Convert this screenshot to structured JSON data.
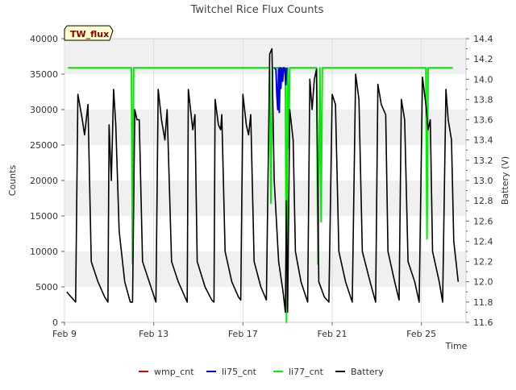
{
  "chart_data": {
    "type": "line",
    "title": "Twitchel Rice Flux Counts",
    "badge": "TW_flux",
    "xlabel": "Time",
    "ylabel": "Counts",
    "y2label": "Battery (V)",
    "x_ticks": [
      {
        "label": "Feb 9",
        "day": 9
      },
      {
        "label": "Feb 13",
        "day": 13
      },
      {
        "label": "Feb 17",
        "day": 17
      },
      {
        "label": "Feb 21",
        "day": 21
      },
      {
        "label": "Feb 25",
        "day": 25
      }
    ],
    "xlim_days": [
      9,
      27
    ],
    "ylim": [
      0,
      40000
    ],
    "y_ticks": [
      0,
      5000,
      10000,
      15000,
      20000,
      25000,
      30000,
      35000,
      40000
    ],
    "y2lim": [
      11.6,
      14.4
    ],
    "y2_ticks": [
      "11.6",
      "11.8",
      "12.0",
      "12.2",
      "12.4",
      "12.6",
      "12.8",
      "13.0",
      "13.2",
      "13.4",
      "13.6",
      "13.8",
      "14.0",
      "14.2",
      "14.4"
    ],
    "grid": "banded",
    "legend_position": "bottom",
    "series": [
      {
        "name": "wmp_cnt",
        "color": "#dd0000",
        "points": []
      },
      {
        "name": "li75_cnt",
        "color": "#0000dd",
        "points": [
          [
            18.42,
            35900
          ],
          [
            18.48,
            35600
          ],
          [
            18.52,
            32000
          ],
          [
            18.56,
            30000
          ],
          [
            18.6,
            35800
          ],
          [
            18.63,
            29600
          ],
          [
            18.67,
            35900
          ],
          [
            18.7,
            33000
          ],
          [
            18.74,
            35800
          ],
          [
            18.78,
            34000
          ],
          [
            18.82,
            35900
          ],
          [
            18.88,
            35800
          ],
          [
            18.92,
            33500
          ],
          [
            18.96,
            35900
          ]
        ]
      },
      {
        "name": "li77_cnt",
        "color": "#00ee00",
        "points": [
          [
            9.15,
            35900
          ],
          [
            11.9,
            35900
          ],
          [
            12.0,
            35900
          ],
          [
            12.05,
            8300
          ],
          [
            12.1,
            35900
          ],
          [
            18.1,
            35900
          ],
          [
            18.2,
            35900
          ],
          [
            18.25,
            16800
          ],
          [
            18.32,
            35900
          ],
          [
            18.5,
            35900
          ],
          [
            18.9,
            35900
          ],
          [
            18.95,
            0
          ],
          [
            19.0,
            35900
          ],
          [
            19.05,
            24500
          ],
          [
            19.1,
            35900
          ],
          [
            20.3,
            35900
          ],
          [
            20.36,
            8200
          ],
          [
            20.45,
            35900
          ],
          [
            20.5,
            14200
          ],
          [
            20.56,
            35900
          ],
          [
            25.2,
            35900
          ],
          [
            25.25,
            11800
          ],
          [
            25.3,
            35900
          ],
          [
            26.4,
            35900
          ]
        ]
      },
      {
        "name": "Battery",
        "color": "#000000",
        "points": [
          [
            9.1,
            11.9
          ],
          [
            9.3,
            11.85
          ],
          [
            9.5,
            11.8
          ],
          [
            9.6,
            13.85
          ],
          [
            9.8,
            13.6
          ],
          [
            9.9,
            13.45
          ],
          [
            10.05,
            13.75
          ],
          [
            10.2,
            12.2
          ],
          [
            10.5,
            12.0
          ],
          [
            10.8,
            11.85
          ],
          [
            10.95,
            11.8
          ],
          [
            11.0,
            13.55
          ],
          [
            11.1,
            13.0
          ],
          [
            11.2,
            13.9
          ],
          [
            11.3,
            13.55
          ],
          [
            11.45,
            12.5
          ],
          [
            11.7,
            12.0
          ],
          [
            11.95,
            11.8
          ],
          [
            12.05,
            11.8
          ],
          [
            12.15,
            13.7
          ],
          [
            12.25,
            13.6
          ],
          [
            12.35,
            13.6
          ],
          [
            12.5,
            12.2
          ],
          [
            12.8,
            12.0
          ],
          [
            13.1,
            11.8
          ],
          [
            13.2,
            13.9
          ],
          [
            13.35,
            13.6
          ],
          [
            13.5,
            13.4
          ],
          [
            13.6,
            13.7
          ],
          [
            13.8,
            12.2
          ],
          [
            14.1,
            12.0
          ],
          [
            14.4,
            11.85
          ],
          [
            14.5,
            11.8
          ],
          [
            14.55,
            13.9
          ],
          [
            14.75,
            13.5
          ],
          [
            14.85,
            13.65
          ],
          [
            14.95,
            12.2
          ],
          [
            15.3,
            11.95
          ],
          [
            15.6,
            11.82
          ],
          [
            15.7,
            11.8
          ],
          [
            15.75,
            13.8
          ],
          [
            15.9,
            13.55
          ],
          [
            16.0,
            13.5
          ],
          [
            16.05,
            13.65
          ],
          [
            16.2,
            12.3
          ],
          [
            16.5,
            12.0
          ],
          [
            16.8,
            11.85
          ],
          [
            16.9,
            11.82
          ],
          [
            17.0,
            13.85
          ],
          [
            17.15,
            13.55
          ],
          [
            17.25,
            13.45
          ],
          [
            17.35,
            13.65
          ],
          [
            17.5,
            12.2
          ],
          [
            17.8,
            11.95
          ],
          [
            18.05,
            11.82
          ],
          [
            18.2,
            14.25
          ],
          [
            18.3,
            14.3
          ],
          [
            18.4,
            13.0
          ],
          [
            18.6,
            12.2
          ],
          [
            18.8,
            11.9
          ],
          [
            18.9,
            11.7
          ],
          [
            18.95,
            12.8
          ],
          [
            19.0,
            11.7
          ],
          [
            19.1,
            13.7
          ],
          [
            19.25,
            13.4
          ],
          [
            19.35,
            12.3
          ],
          [
            19.6,
            12.0
          ],
          [
            19.9,
            11.8
          ],
          [
            20.0,
            14.0
          ],
          [
            20.1,
            13.7
          ],
          [
            20.2,
            14.0
          ],
          [
            20.3,
            14.1
          ],
          [
            20.4,
            12.0
          ],
          [
            20.65,
            11.85
          ],
          [
            20.85,
            11.8
          ],
          [
            21.0,
            13.85
          ],
          [
            21.15,
            13.75
          ],
          [
            21.3,
            12.3
          ],
          [
            21.6,
            12.0
          ],
          [
            21.9,
            11.8
          ],
          [
            22.05,
            14.05
          ],
          [
            22.2,
            13.8
          ],
          [
            22.35,
            12.3
          ],
          [
            22.7,
            12.0
          ],
          [
            22.95,
            11.8
          ],
          [
            23.05,
            13.95
          ],
          [
            23.2,
            13.75
          ],
          [
            23.4,
            13.65
          ],
          [
            23.5,
            12.3
          ],
          [
            23.8,
            12.0
          ],
          [
            24.0,
            11.82
          ],
          [
            24.1,
            13.8
          ],
          [
            24.25,
            13.6
          ],
          [
            24.4,
            12.2
          ],
          [
            24.7,
            12.0
          ],
          [
            24.9,
            11.8
          ],
          [
            25.05,
            14.02
          ],
          [
            25.2,
            13.75
          ],
          [
            25.3,
            13.5
          ],
          [
            25.4,
            13.6
          ],
          [
            25.5,
            12.3
          ],
          [
            25.8,
            12.0
          ],
          [
            25.95,
            11.8
          ],
          [
            26.1,
            13.9
          ],
          [
            26.2,
            13.6
          ],
          [
            26.35,
            13.4
          ],
          [
            26.45,
            12.4
          ],
          [
            26.55,
            12.2
          ],
          [
            26.65,
            12.0
          ]
        ]
      }
    ]
  }
}
